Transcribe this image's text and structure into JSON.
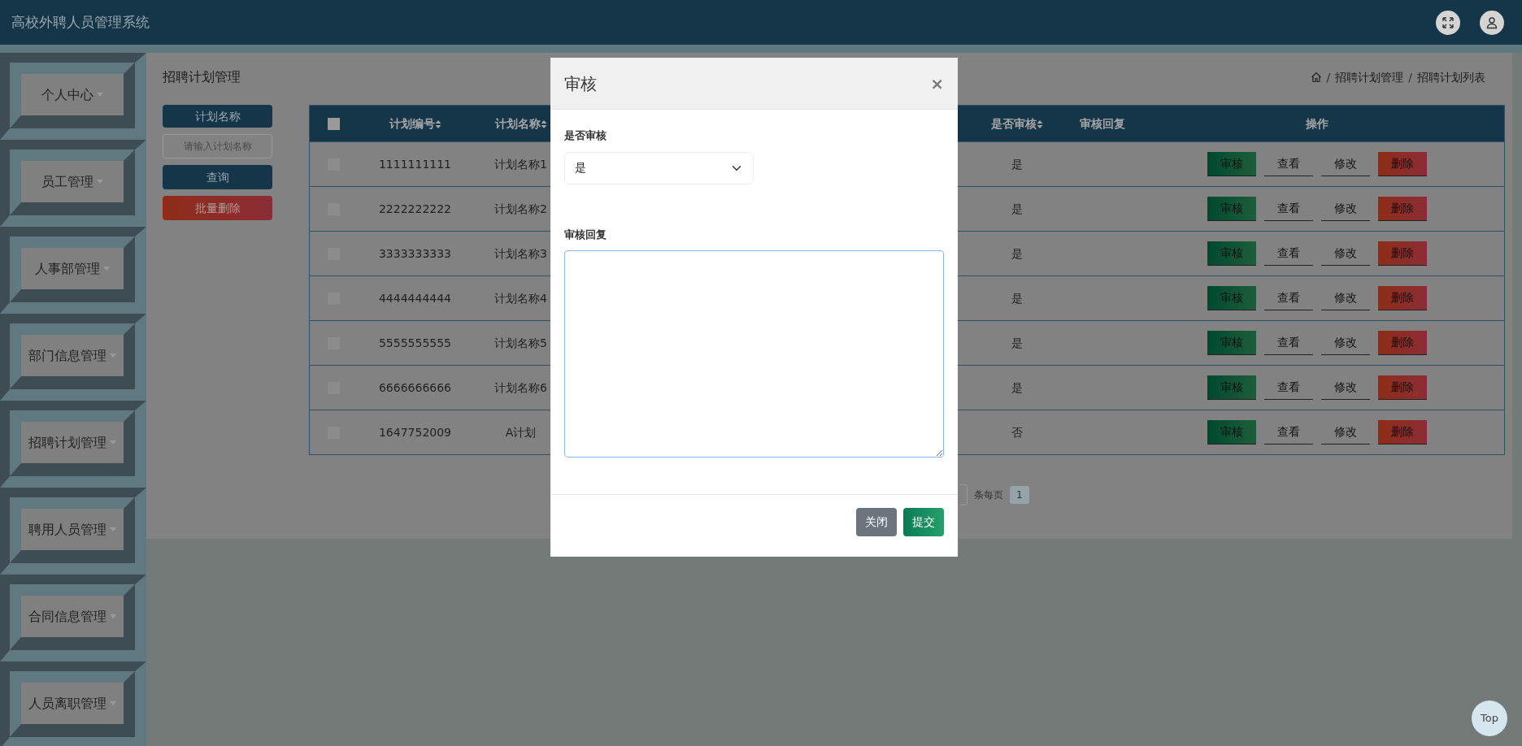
{
  "app": {
    "title": "高校外聘人员管理系统"
  },
  "sidebar": {
    "items": [
      {
        "label": "个人中心"
      },
      {
        "label": "员工管理"
      },
      {
        "label": "人事部管理"
      },
      {
        "label": "部门信息管理"
      },
      {
        "label": "招聘计划管理"
      },
      {
        "label": "聘用人员管理"
      },
      {
        "label": "合同信息管理"
      },
      {
        "label": "人员离职管理"
      }
    ]
  },
  "page": {
    "title": "招聘计划管理",
    "breadcrumb": [
      {
        "kind": "separator",
        "text": "/"
      },
      {
        "kind": "link",
        "text": "招聘计划管理"
      },
      {
        "kind": "separator",
        "text": "/"
      },
      {
        "kind": "link",
        "text": "招聘计划列表"
      }
    ]
  },
  "search": {
    "label": "计划名称",
    "placeholder": "请输入计划名称",
    "buttons": [
      {
        "label": "查询",
        "kind": "query"
      },
      {
        "label": "批量删除",
        "kind": "danger"
      }
    ]
  },
  "table": {
    "select_all": {
      "checked": false
    },
    "columns": [
      {
        "label": "计划编号",
        "sortable": true
      },
      {
        "label": "计划名称",
        "sortable": true
      },
      {
        "label": "是否审核",
        "sortable": true
      },
      {
        "label": "审核回复",
        "sortable": false
      },
      {
        "label": "操作",
        "sortable": false
      }
    ],
    "rows": [
      {
        "checked": false,
        "code": "1111111111",
        "name": "计划名称1",
        "approved": "是",
        "actions": [
          {
            "label": "审核",
            "kind": "review"
          },
          {
            "label": "查看",
            "kind": "plain"
          },
          {
            "label": "修改",
            "kind": "plain"
          },
          {
            "label": "删除",
            "kind": "danger"
          }
        ]
      },
      {
        "checked": false,
        "code": "2222222222",
        "name": "计划名称2",
        "approved": "是",
        "actions": [
          {
            "label": "审核",
            "kind": "review"
          },
          {
            "label": "查看",
            "kind": "plain"
          },
          {
            "label": "修改",
            "kind": "plain"
          },
          {
            "label": "删除",
            "kind": "danger"
          }
        ]
      },
      {
        "checked": false,
        "code": "3333333333",
        "name": "计划名称3",
        "approved": "是",
        "actions": [
          {
            "label": "审核",
            "kind": "review"
          },
          {
            "label": "查看",
            "kind": "plain"
          },
          {
            "label": "修改",
            "kind": "plain"
          },
          {
            "label": "删除",
            "kind": "danger"
          }
        ]
      },
      {
        "checked": false,
        "code": "4444444444",
        "name": "计划名称4",
        "approved": "是",
        "actions": [
          {
            "label": "审核",
            "kind": "review"
          },
          {
            "label": "查看",
            "kind": "plain"
          },
          {
            "label": "修改",
            "kind": "plain"
          },
          {
            "label": "删除",
            "kind": "danger"
          }
        ]
      },
      {
        "checked": false,
        "code": "5555555555",
        "name": "计划名称5",
        "approved": "是",
        "actions": [
          {
            "label": "审核",
            "kind": "review"
          },
          {
            "label": "查看",
            "kind": "plain"
          },
          {
            "label": "修改",
            "kind": "plain"
          },
          {
            "label": "删除",
            "kind": "danger"
          }
        ]
      },
      {
        "checked": false,
        "code": "6666666666",
        "name": "计划名称6",
        "approved": "是",
        "actions": [
          {
            "label": "审核",
            "kind": "review"
          },
          {
            "label": "查看",
            "kind": "plain"
          },
          {
            "label": "修改",
            "kind": "plain"
          },
          {
            "label": "删除",
            "kind": "danger"
          }
        ]
      },
      {
        "checked": false,
        "code": "1647752009",
        "name": "A计划",
        "approved": "否",
        "actions": [
          {
            "label": "审核",
            "kind": "review"
          },
          {
            "label": "查看",
            "kind": "plain"
          },
          {
            "label": "修改",
            "kind": "plain"
          },
          {
            "label": "删除",
            "kind": "danger"
          }
        ]
      }
    ]
  },
  "pagination": {
    "per_page_label": "条每页",
    "pages": [
      {
        "label": "1",
        "selected": true
      }
    ]
  },
  "modal": {
    "title": "审核",
    "close": "×",
    "fields": [
      {
        "kind": "select",
        "label": "是否审核",
        "value": "是"
      },
      {
        "kind": "textarea",
        "label": "审核回复"
      }
    ],
    "buttons": [
      {
        "label": "关闭",
        "kind": "secondary"
      },
      {
        "label": "提交",
        "kind": "primary"
      }
    ]
  },
  "back_to_top": {
    "label": "Top"
  }
}
